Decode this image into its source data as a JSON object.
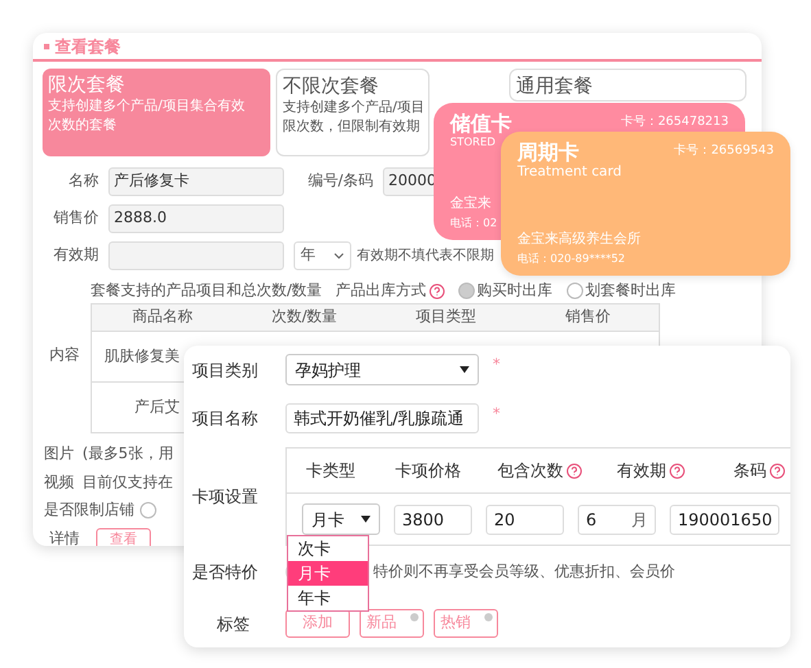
{
  "package_window": {
    "title": "查看套餐",
    "package_types": [
      {
        "title": "限次套餐",
        "lines": [
          "支持创建多个产品/项目集合有效",
          "次数的套餐"
        ],
        "selected": true
      },
      {
        "title": "不限次套餐",
        "lines": [
          "支持创建多个产品/项目",
          "限次数，但限制有效期"
        ],
        "selected": false
      },
      {
        "title": "通用套餐",
        "selected": false
      }
    ],
    "name": {
      "label": "名称",
      "value": "产后修复卡"
    },
    "code": {
      "label": "编号/条码",
      "value": "20000"
    },
    "price": {
      "label": "销售价",
      "value": "2888.0"
    },
    "validity": {
      "label": "有效期",
      "unit": "年",
      "hint": "有效期不填代表不限期"
    },
    "content": {
      "label": "内容",
      "caption": "套餐支持的产品项目和总次数/数量",
      "stock_label": "产品出库方式",
      "stock_options": [
        {
          "label": "购买时出库",
          "selected": true
        },
        {
          "label": "划套餐时出库",
          "selected": false
        }
      ],
      "columns": [
        "商品名称",
        "次数/数量",
        "项目类型",
        "销售价"
      ],
      "rows": [
        "肌肤修复美",
        "产后艾"
      ]
    },
    "images": {
      "label": "图片",
      "hint": "(最多5张，用"
    },
    "video": {
      "label": "视频",
      "hint": "目前仅支持在"
    },
    "store_limit": {
      "label": "是否限制店铺",
      "selected": false
    },
    "details": {
      "label": "详情",
      "button": "查看"
    }
  },
  "stored_card": {
    "title": "储值卡",
    "subtitle": "STORED",
    "number": "卡号：265478213",
    "shop": "金宝来",
    "phone": "电话：02",
    "color": "#ff8ba0"
  },
  "cycle_card": {
    "title": "周期卡",
    "subtitle": "Treatment card",
    "number": "卡号：26569543",
    "shop": "金宝来高级养生会所",
    "phone": "电话：020-89****52",
    "color": "#ffb878"
  },
  "item_window": {
    "category": {
      "label": "项目类别",
      "value": "孕妈护理",
      "required_mark": "*"
    },
    "item_name": {
      "label": "项目名称",
      "value": "韩式开奶催乳/乳腺疏通",
      "required_mark": "*"
    },
    "settings": {
      "label": "卡项设置",
      "columns": [
        {
          "label": "卡类型"
        },
        {
          "label": "卡项价格"
        },
        {
          "label": "包含次数",
          "help": true
        },
        {
          "label": "有效期",
          "help": true
        },
        {
          "label": "条码",
          "help": true
        }
      ],
      "card_type": "月卡",
      "price": "3800",
      "times": "20",
      "period": "6",
      "period_unit": "月",
      "barcode": "190001650",
      "card_type_options": [
        {
          "label": "次卡",
          "selected": false
        },
        {
          "label": "月卡",
          "selected": true
        },
        {
          "label": "年卡",
          "selected": false
        }
      ]
    },
    "special": {
      "label": "是否特价",
      "on": false,
      "note": "特价则不再享受会员等级、优惠折扣、会员价"
    },
    "tags": {
      "label": "标签",
      "add": "添加",
      "items": [
        "新品",
        "热销"
      ]
    }
  }
}
